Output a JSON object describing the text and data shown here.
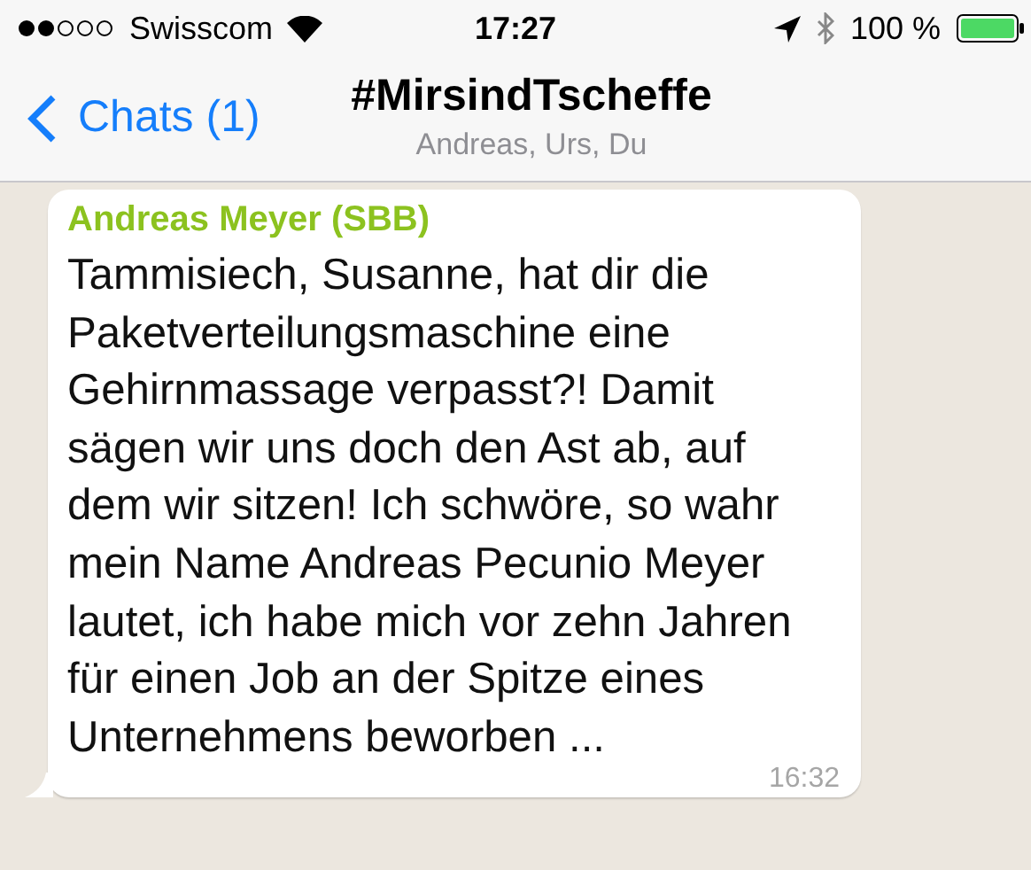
{
  "status_bar": {
    "carrier": "Swisscom",
    "time": "17:27",
    "battery": "100 %"
  },
  "nav_bar": {
    "back_label": "Chats (1)",
    "title": "#MirsindTscheffe",
    "subtitle": "Andreas, Urs, Du"
  },
  "messages": [
    {
      "sender": "Andreas Meyer (SBB)",
      "text": "Tammisiech, Susanne, hat dir die Paketverteilungsmaschine eine Gehirnmassage verpasst?! Damit sägen wir uns doch den Ast ab, auf dem wir sitzen! Ich schwöre, so wahr mein Name Andreas Pecunio Meyer lautet, ich habe mich vor zehn Jahren für einen Job an der Spitze eines Unternehmens beworben ...",
      "time": "16:32"
    }
  ]
}
